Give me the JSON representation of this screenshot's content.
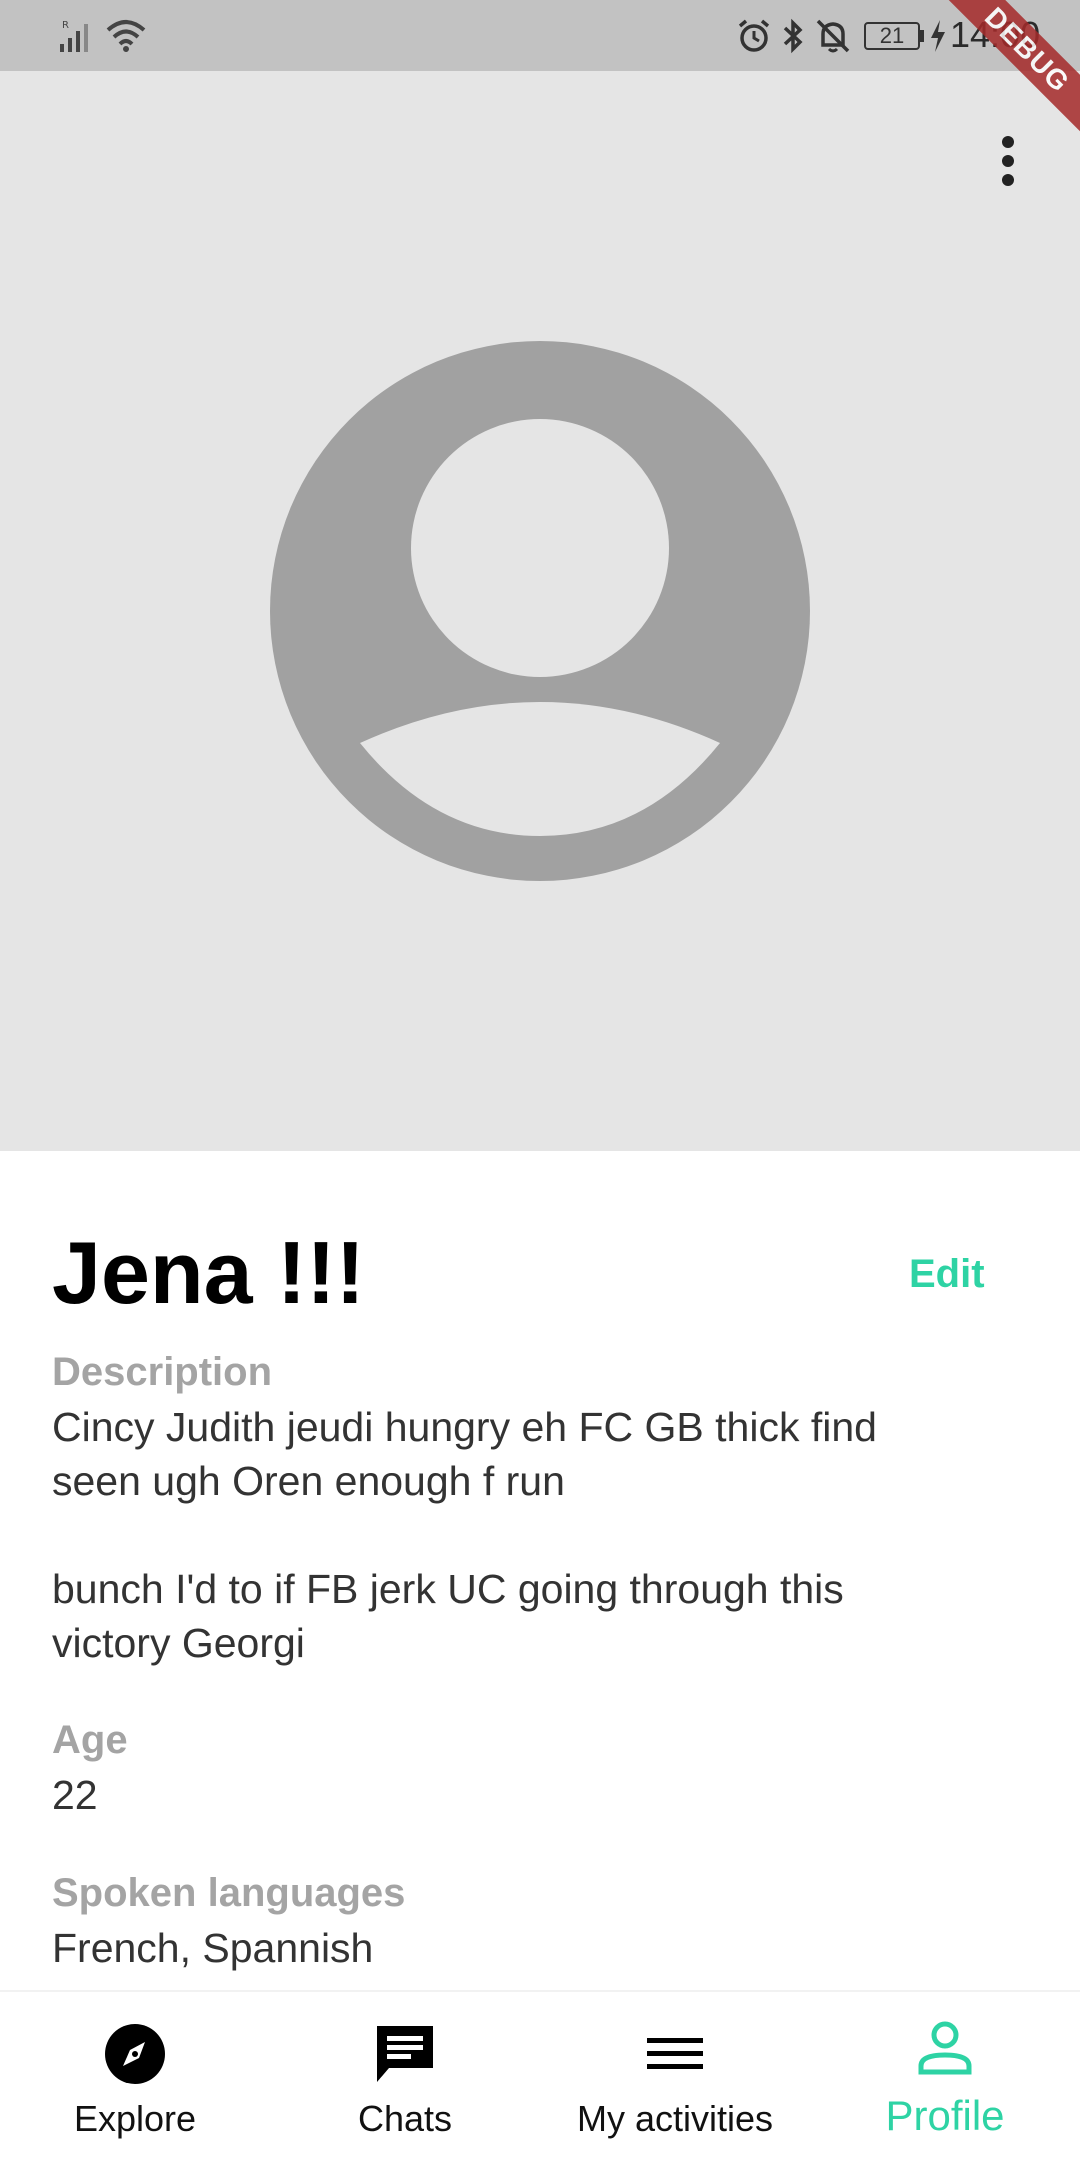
{
  "status_bar": {
    "time": "14:00",
    "battery": "21",
    "icons": [
      "signal-icon",
      "wifi-icon",
      "alarm-icon",
      "bluetooth-icon",
      "bell-off-icon",
      "battery-icon",
      "charging-icon"
    ]
  },
  "debug_banner": "DEBUG",
  "profile": {
    "name": "Jena !!!",
    "edit_label": "Edit",
    "description_label": "Description",
    "description_line1": "Cincy Judith jeudi hungry eh FC GB thick find",
    "description_line2": "seen ugh Oren enough f run",
    "description_line3": "bunch I'd to if FB jerk UC going through this",
    "description_line4": "victory Georgi",
    "age_label": "Age",
    "age_value": "22",
    "languages_label": "Spoken languages",
    "languages_value": "French, Spannish"
  },
  "nav": {
    "items": [
      {
        "label": "Explore",
        "icon": "compass-icon"
      },
      {
        "label": "Chats",
        "icon": "chat-icon"
      },
      {
        "label": "My activities",
        "icon": "list-icon"
      },
      {
        "label": "Profile",
        "icon": "person-icon"
      }
    ],
    "active_index": 3
  },
  "colors": {
    "accent": "#2ed3a4",
    "status_bar": "#c2c2c2",
    "hero_bg": "#e5e5e5",
    "avatar": "#a1a1a1",
    "label": "#a4a4a4"
  }
}
